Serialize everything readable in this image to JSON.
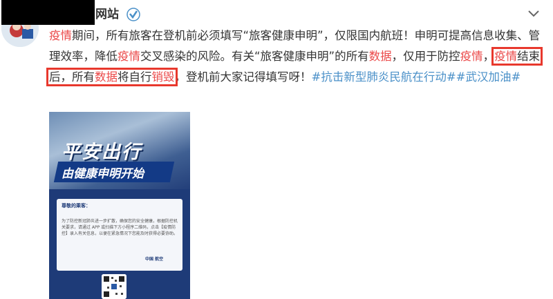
{
  "account": {
    "name_suffix": "网站"
  },
  "post": {
    "segments": [
      {
        "text": "疫情",
        "style": "hl"
      },
      {
        "text": "期间，所有旅客在登机前必须填写“旅客健康申明”，仅限国内航班！申明可提高信息收集、管理效率，降低",
        "style": "plain"
      },
      {
        "text": "疫情",
        "style": "hl"
      },
      {
        "text": "交叉感染的风险。有关“旅客健康申明”的所有",
        "style": "plain"
      },
      {
        "text": "数据",
        "style": "hl"
      },
      {
        "text": "，仅用于防控",
        "style": "plain"
      },
      {
        "text": "疫情",
        "style": "hl"
      },
      {
        "text": "，",
        "style": "plain"
      }
    ],
    "boxed": [
      {
        "text": "疫情",
        "style": "hl"
      },
      {
        "text": "结束后，所有",
        "style": "plain"
      },
      {
        "text": "数据",
        "style": "hl"
      },
      {
        "text": "将自行",
        "style": "plain"
      },
      {
        "text": "销毁",
        "style": "hl"
      }
    ],
    "after_box": "，登机前大家记得填写呀！",
    "tags": [
      "#抗击新型肺炎民航在行动#",
      "#武汉加油#"
    ]
  },
  "poster": {
    "title1": "平安出行",
    "title2": "由健康申明开始",
    "greeting": "尊敬的乘客：",
    "body": "为了防控新冠肺炎进一步扩散，确保您的安全健康，根据防控机关要求，请通过 APP 或扫描下方小程序二维码，点击【疫情防控】录入有关信息，以便在紧急情况下您能及时获得必要协助。",
    "sign": "中国  航空"
  },
  "colors": {
    "highlight": "#eb4a4a",
    "hashtag": "#4a90c8",
    "box": "#e8382d",
    "poster_bg": "#1e3b78"
  }
}
